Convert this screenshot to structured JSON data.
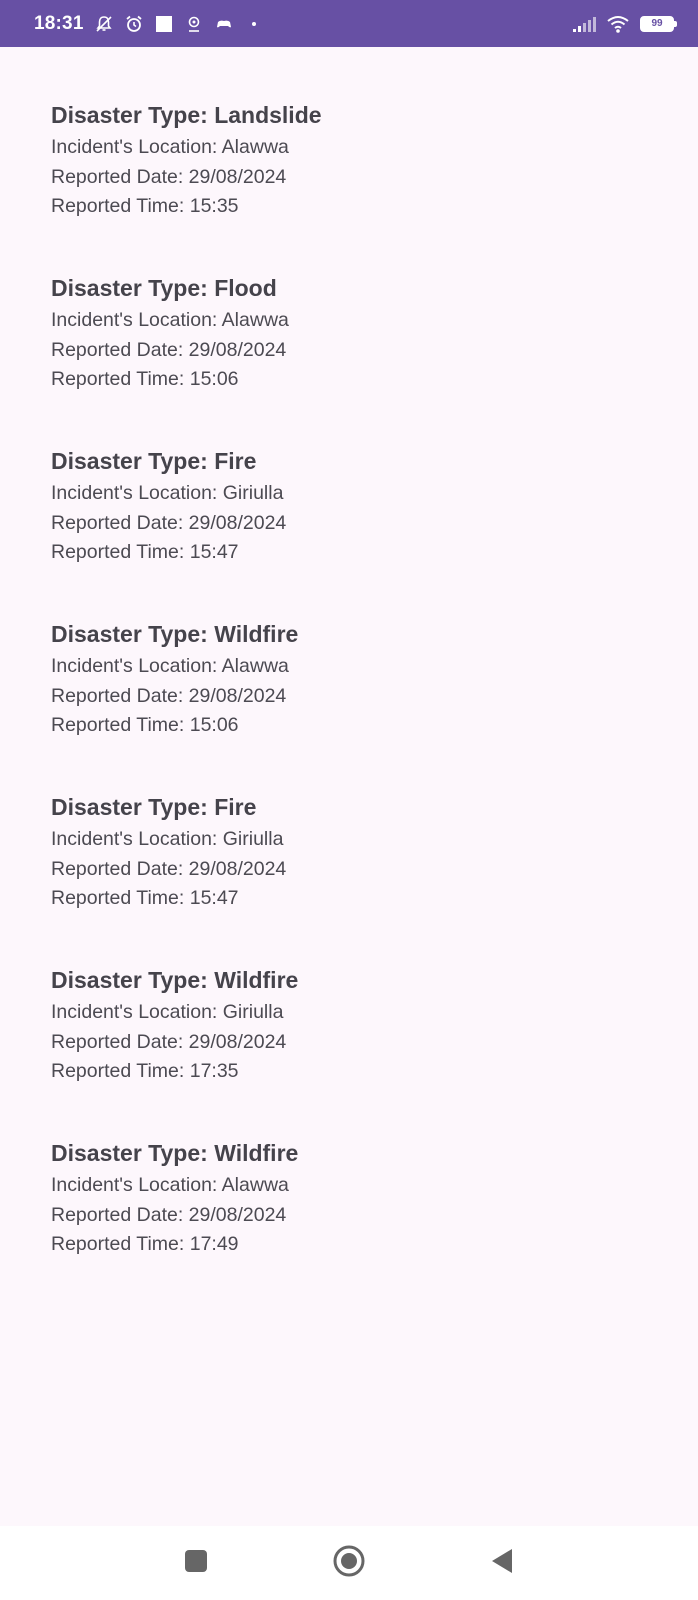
{
  "status_bar": {
    "time": "18:31",
    "battery": "99",
    "background_color": "#6750a4",
    "left_icons": [
      "muted-notifications-icon",
      "alarm-icon",
      "square-notification-icon",
      "location-icon",
      "game-controller-icon",
      "dot-icon"
    ],
    "right_icons": [
      "signal-icon",
      "wifi-icon",
      "battery-icon"
    ]
  },
  "reports": [
    {
      "title": "Disaster Type: Landslide",
      "location": "Incident's Location: Alawwa",
      "date": "Reported Date: 29/08/2024",
      "time": "Reported Time: 15:35"
    },
    {
      "title": "Disaster Type: Flood",
      "location": "Incident's Location: Alawwa",
      "date": "Reported Date: 29/08/2024",
      "time": "Reported Time: 15:06"
    },
    {
      "title": "Disaster Type: Fire",
      "location": "Incident's Location: Giriulla",
      "date": "Reported Date: 29/08/2024",
      "time": "Reported Time: 15:47"
    },
    {
      "title": "Disaster Type: Wildfire",
      "location": "Incident's Location: Alawwa",
      "date": "Reported Date: 29/08/2024",
      "time": "Reported Time: 15:06"
    },
    {
      "title": "Disaster Type: Fire",
      "location": "Incident's Location: Giriulla",
      "date": "Reported Date: 29/08/2024",
      "time": "Reported Time: 15:47"
    },
    {
      "title": "Disaster Type: Wildfire",
      "location": "Incident's Location: Giriulla",
      "date": "Reported Date: 29/08/2024",
      "time": "Reported Time: 17:35"
    },
    {
      "title": "Disaster Type: Wildfire",
      "location": "Incident's Location: Alawwa",
      "date": "Reported Date: 29/08/2024",
      "time": "Reported Time: 17:49"
    }
  ],
  "nav_bar": {
    "icons": [
      "recent-apps-icon",
      "home-icon",
      "back-icon"
    ],
    "icon_color": "#666666"
  },
  "colors": {
    "page_background": "#fdf7fc",
    "title_text": "#45434b",
    "body_text": "#4c4a52"
  }
}
